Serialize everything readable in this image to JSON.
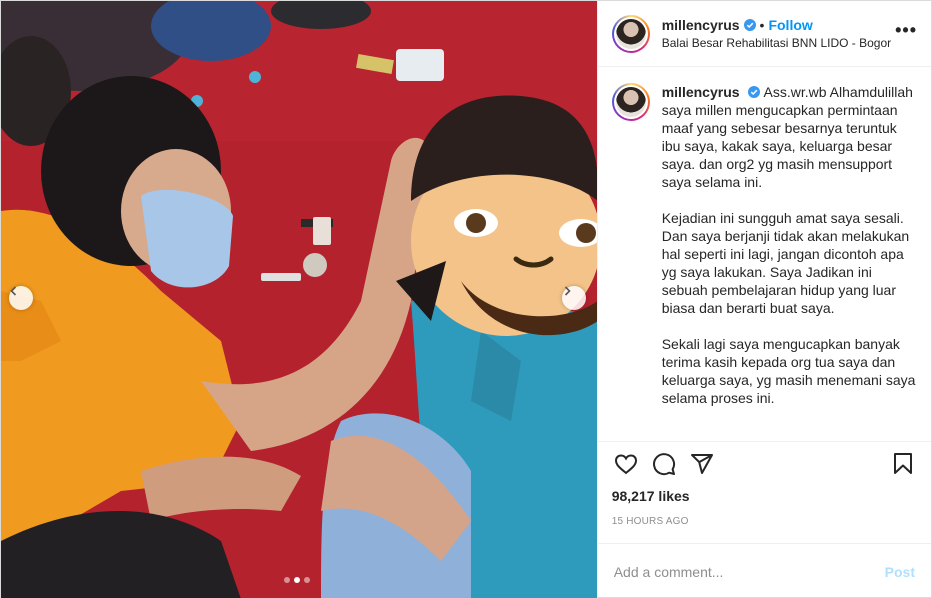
{
  "post": {
    "username": "millencyrus",
    "follow_label": "Follow",
    "separator": "•",
    "location": "Balai Besar Rehabilitasi BNN LIDO - Bogor",
    "more_label": "•••"
  },
  "caption": {
    "username": "millencyrus",
    "paragraphs": [
      "Ass.wr.wb Alhamdulillah saya millen mengucapkan permintaan maaf yang sebesar besarnya teruntuk ibu saya, kakak saya, keluarga besar saya. dan org2 yg masih mensupport saya selama ini.",
      "Kejadian ini sungguh amat saya sesali. Dan saya berjanji tidak akan melakukan hal seperti ini lagi, jangan dicontoh apa yg saya lakukan. Saya Jadikan ini sebuah pembelajaran hidup yang luar biasa dan berarti buat saya.",
      "Sekali lagi saya mengucapkan banyak terima kasih kepada org tua saya dan keluarga saya, yg masih menemani saya selama proses ini."
    ]
  },
  "engagement": {
    "likes": "98,217 likes",
    "time": "15 HOURS AGO"
  },
  "comment": {
    "placeholder": "Add a comment...",
    "post_label": "Post"
  },
  "icons": {
    "like": "heart-icon",
    "comment": "comment-icon",
    "share": "share-icon",
    "save": "bookmark-icon",
    "verified": "verified-badge-icon"
  },
  "carousel": {
    "slides": 3,
    "active_slide": 2
  },
  "colors": {
    "follow": "#0095f6",
    "verified": "#3897f0",
    "post_disabled": "#b2dffc"
  }
}
